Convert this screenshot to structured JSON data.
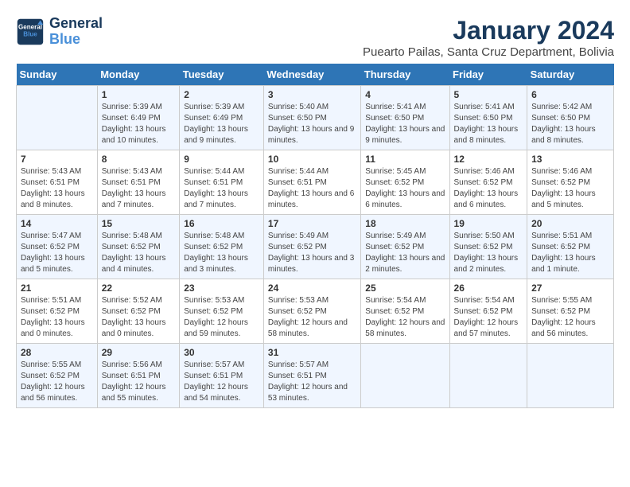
{
  "logo": {
    "line1": "General",
    "line2": "Blue"
  },
  "title": "January 2024",
  "subtitle": "Puearto Pailas, Santa Cruz Department, Bolivia",
  "days_of_week": [
    "Sunday",
    "Monday",
    "Tuesday",
    "Wednesday",
    "Thursday",
    "Friday",
    "Saturday"
  ],
  "weeks": [
    [
      {
        "day": "",
        "content": ""
      },
      {
        "day": "1",
        "content": "Sunrise: 5:39 AM\nSunset: 6:49 PM\nDaylight: 13 hours\nand 10 minutes."
      },
      {
        "day": "2",
        "content": "Sunrise: 5:39 AM\nSunset: 6:49 PM\nDaylight: 13 hours\nand 9 minutes."
      },
      {
        "day": "3",
        "content": "Sunrise: 5:40 AM\nSunset: 6:50 PM\nDaylight: 13 hours\nand 9 minutes."
      },
      {
        "day": "4",
        "content": "Sunrise: 5:41 AM\nSunset: 6:50 PM\nDaylight: 13 hours\nand 9 minutes."
      },
      {
        "day": "5",
        "content": "Sunrise: 5:41 AM\nSunset: 6:50 PM\nDaylight: 13 hours\nand 8 minutes."
      },
      {
        "day": "6",
        "content": "Sunrise: 5:42 AM\nSunset: 6:50 PM\nDaylight: 13 hours\nand 8 minutes."
      }
    ],
    [
      {
        "day": "7",
        "content": "Sunrise: 5:43 AM\nSunset: 6:51 PM\nDaylight: 13 hours\nand 8 minutes."
      },
      {
        "day": "8",
        "content": "Sunrise: 5:43 AM\nSunset: 6:51 PM\nDaylight: 13 hours\nand 7 minutes."
      },
      {
        "day": "9",
        "content": "Sunrise: 5:44 AM\nSunset: 6:51 PM\nDaylight: 13 hours\nand 7 minutes."
      },
      {
        "day": "10",
        "content": "Sunrise: 5:44 AM\nSunset: 6:51 PM\nDaylight: 13 hours\nand 6 minutes."
      },
      {
        "day": "11",
        "content": "Sunrise: 5:45 AM\nSunset: 6:52 PM\nDaylight: 13 hours\nand 6 minutes."
      },
      {
        "day": "12",
        "content": "Sunrise: 5:46 AM\nSunset: 6:52 PM\nDaylight: 13 hours\nand 6 minutes."
      },
      {
        "day": "13",
        "content": "Sunrise: 5:46 AM\nSunset: 6:52 PM\nDaylight: 13 hours\nand 5 minutes."
      }
    ],
    [
      {
        "day": "14",
        "content": "Sunrise: 5:47 AM\nSunset: 6:52 PM\nDaylight: 13 hours\nand 5 minutes."
      },
      {
        "day": "15",
        "content": "Sunrise: 5:48 AM\nSunset: 6:52 PM\nDaylight: 13 hours\nand 4 minutes."
      },
      {
        "day": "16",
        "content": "Sunrise: 5:48 AM\nSunset: 6:52 PM\nDaylight: 13 hours\nand 3 minutes."
      },
      {
        "day": "17",
        "content": "Sunrise: 5:49 AM\nSunset: 6:52 PM\nDaylight: 13 hours\nand 3 minutes."
      },
      {
        "day": "18",
        "content": "Sunrise: 5:49 AM\nSunset: 6:52 PM\nDaylight: 13 hours\nand 2 minutes."
      },
      {
        "day": "19",
        "content": "Sunrise: 5:50 AM\nSunset: 6:52 PM\nDaylight: 13 hours\nand 2 minutes."
      },
      {
        "day": "20",
        "content": "Sunrise: 5:51 AM\nSunset: 6:52 PM\nDaylight: 13 hours\nand 1 minute."
      }
    ],
    [
      {
        "day": "21",
        "content": "Sunrise: 5:51 AM\nSunset: 6:52 PM\nDaylight: 13 hours\nand 0 minutes."
      },
      {
        "day": "22",
        "content": "Sunrise: 5:52 AM\nSunset: 6:52 PM\nDaylight: 13 hours\nand 0 minutes."
      },
      {
        "day": "23",
        "content": "Sunrise: 5:53 AM\nSunset: 6:52 PM\nDaylight: 12 hours\nand 59 minutes."
      },
      {
        "day": "24",
        "content": "Sunrise: 5:53 AM\nSunset: 6:52 PM\nDaylight: 12 hours\nand 58 minutes."
      },
      {
        "day": "25",
        "content": "Sunrise: 5:54 AM\nSunset: 6:52 PM\nDaylight: 12 hours\nand 58 minutes."
      },
      {
        "day": "26",
        "content": "Sunrise: 5:54 AM\nSunset: 6:52 PM\nDaylight: 12 hours\nand 57 minutes."
      },
      {
        "day": "27",
        "content": "Sunrise: 5:55 AM\nSunset: 6:52 PM\nDaylight: 12 hours\nand 56 minutes."
      }
    ],
    [
      {
        "day": "28",
        "content": "Sunrise: 5:55 AM\nSunset: 6:52 PM\nDaylight: 12 hours\nand 56 minutes."
      },
      {
        "day": "29",
        "content": "Sunrise: 5:56 AM\nSunset: 6:51 PM\nDaylight: 12 hours\nand 55 minutes."
      },
      {
        "day": "30",
        "content": "Sunrise: 5:57 AM\nSunset: 6:51 PM\nDaylight: 12 hours\nand 54 minutes."
      },
      {
        "day": "31",
        "content": "Sunrise: 5:57 AM\nSunset: 6:51 PM\nDaylight: 12 hours\nand 53 minutes."
      },
      {
        "day": "",
        "content": ""
      },
      {
        "day": "",
        "content": ""
      },
      {
        "day": "",
        "content": ""
      }
    ]
  ]
}
